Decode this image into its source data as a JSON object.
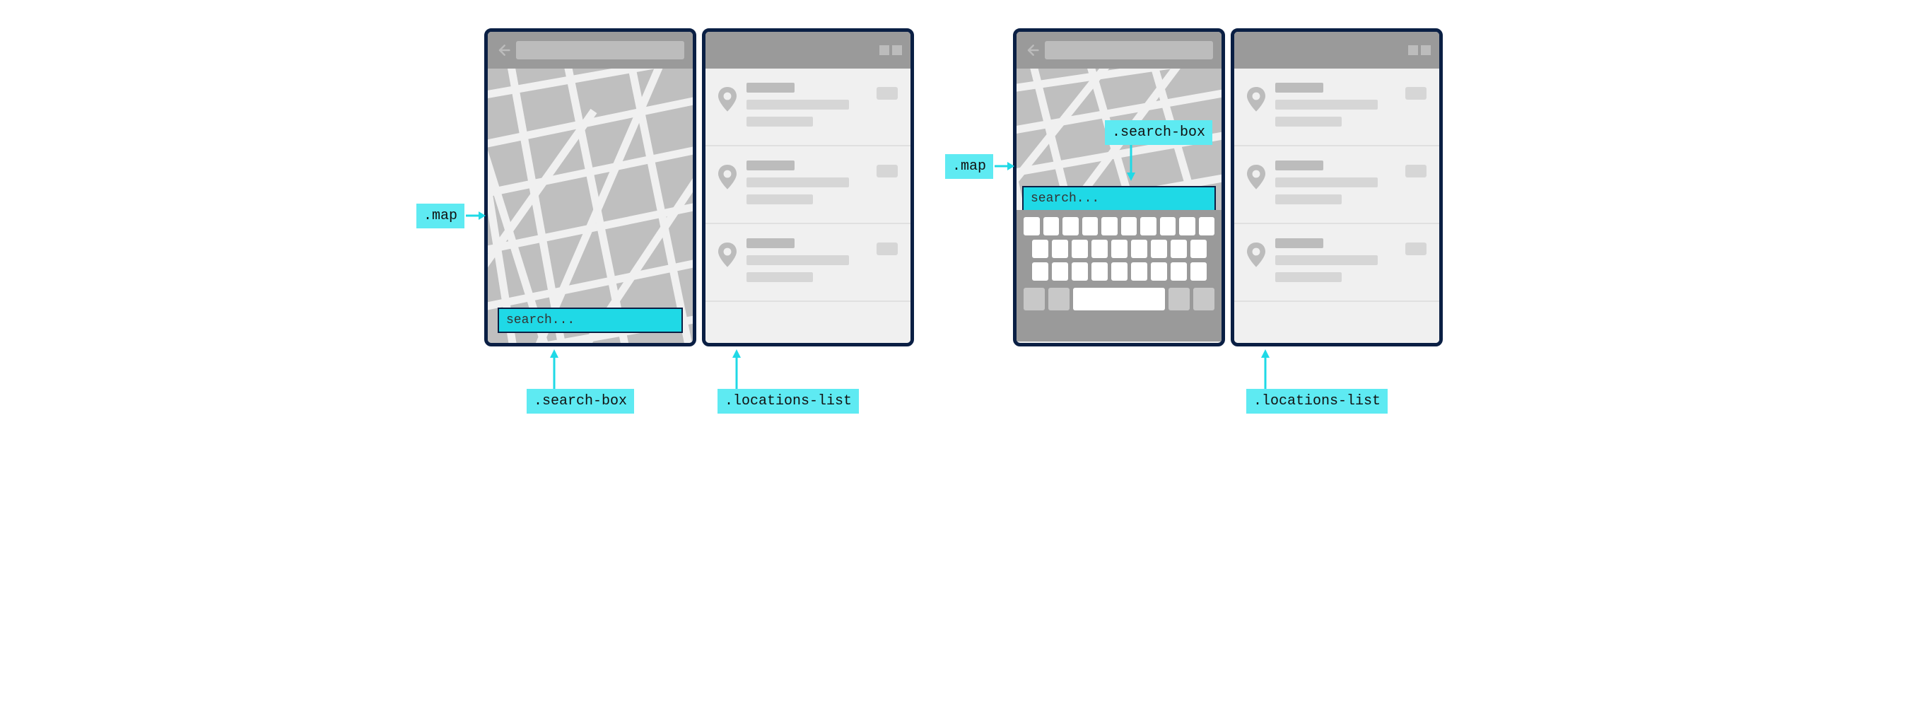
{
  "annotations": {
    "map": ".map",
    "search_box": ".search-box",
    "locations_list": ".locations-list"
  },
  "search": {
    "placeholder": "search..."
  },
  "colors": {
    "highlight": "#1fd9e6",
    "device_border": "#0a1f44",
    "titlebar": "#9a9a9a",
    "placeholder_gray": "#bcbcbc"
  },
  "diagram": {
    "description": "Two side-by-side tablet wireframe mockups. Each mockup has a map pane on the left and a locations list pane on the right. In the left mockup the search box sits at the bottom of the map. In the right mockup the search box has moved up and an on-screen keyboard fills the lower portion of the map pane. Cyan labels with arrows call out .map, .search-box and .locations-list CSS class selectors in both mockups."
  }
}
